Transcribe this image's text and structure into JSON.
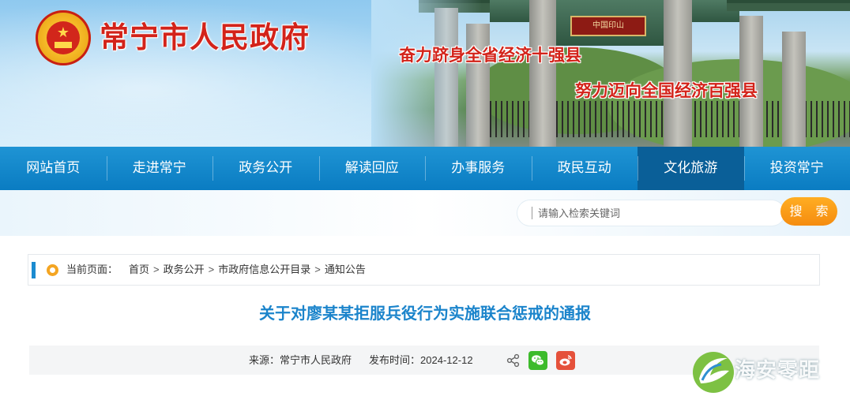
{
  "header": {
    "site_title": "常宁市人民政府",
    "slogan_1": "奋力跻身全省经济十强县",
    "slogan_2": "努力迈向全国经济百强县",
    "gate_sign": "中国印山"
  },
  "nav": {
    "items": [
      {
        "label": "网站首页"
      },
      {
        "label": "走进常宁"
      },
      {
        "label": "政务公开"
      },
      {
        "label": "解读回应"
      },
      {
        "label": "办事服务"
      },
      {
        "label": "政民互动"
      },
      {
        "label": "文化旅游",
        "active": true
      },
      {
        "label": "投资常宁"
      }
    ]
  },
  "search": {
    "placeholder": "请输入检索关键词",
    "button_label": "搜 索"
  },
  "breadcrumb": {
    "label": "当前页面：",
    "items": [
      "首页",
      "政务公开",
      "市政府信息公开目录",
      "通知公告"
    ]
  },
  "article": {
    "title": "关于对廖某某拒服兵役行为实施联合惩戒的通报",
    "source_label": "来源：",
    "source": "常宁市人民政府",
    "date_label": "发布时间：",
    "date": "2024-12-12"
  },
  "watermark": {
    "text": "海安零距"
  },
  "colors": {
    "nav_bg": "#0a7cc2",
    "nav_active": "#0a5f98",
    "title_red": "#d3231a",
    "article_title": "#1b84cb",
    "search_button": "#f58c0f"
  }
}
